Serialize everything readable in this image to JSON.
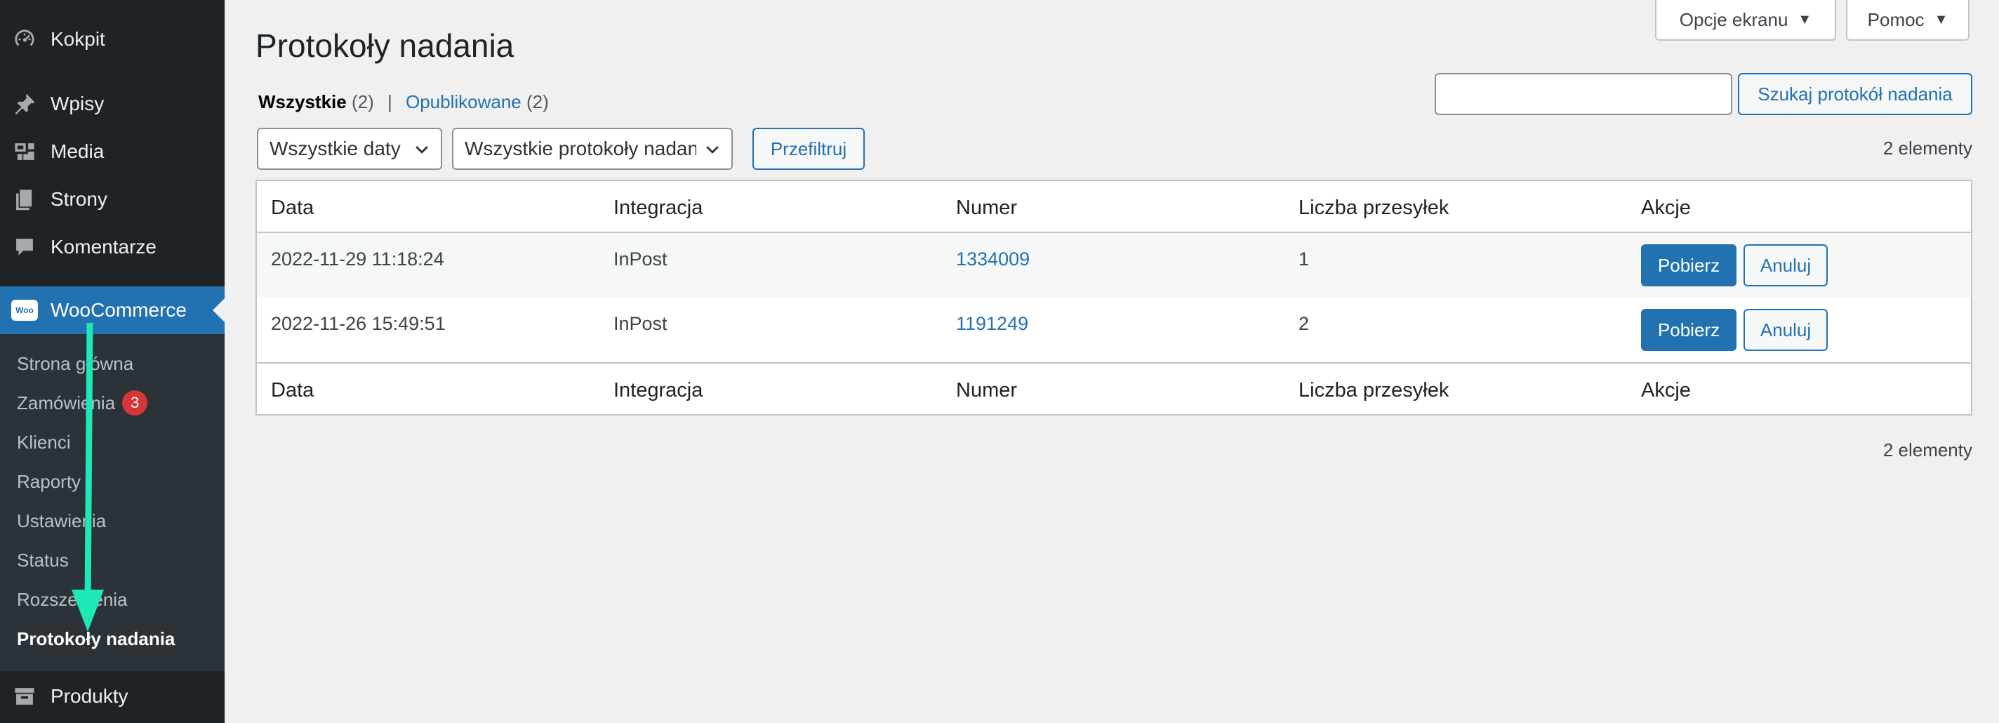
{
  "sidebar": {
    "menu": [
      {
        "label": "Kokpit",
        "icon": "dashboard-icon"
      },
      {
        "label": "Wpisy",
        "icon": "pin-icon"
      },
      {
        "label": "Media",
        "icon": "media-icon"
      },
      {
        "label": "Strony",
        "icon": "pages-icon"
      },
      {
        "label": "Komentarze",
        "icon": "comment-icon"
      },
      {
        "label": "WooCommerce",
        "icon": "woo-icon"
      },
      {
        "label": "Produkty",
        "icon": "archive-icon"
      }
    ],
    "woo_logo_text": "Woo",
    "submenu": [
      {
        "label": "Strona główna"
      },
      {
        "label": "Zamówienia",
        "badge": "3"
      },
      {
        "label": "Klienci"
      },
      {
        "label": "Raporty"
      },
      {
        "label": "Ustawienia"
      },
      {
        "label": "Status"
      },
      {
        "label": "Rozszerzenia"
      },
      {
        "label": "Protokoły nadania"
      }
    ]
  },
  "header": {
    "screen_options": "Opcje ekranu",
    "help": "Pomoc",
    "title": "Protokoły nadania"
  },
  "views": {
    "all_label": "Wszystkie",
    "all_count": "(2)",
    "separator": "|",
    "published_label": "Opublikowane",
    "published_count": "(2)"
  },
  "search": {
    "value": "",
    "button": "Szukaj protokół nadania"
  },
  "filters": {
    "dates": "Wszystkie daty",
    "protocols": "Wszystkie protokoły nadania",
    "button": "Przefiltruj"
  },
  "items_count": "2 elementy",
  "table": {
    "columns": [
      "Data",
      "Integracja",
      "Numer",
      "Liczba przesyłek",
      "Akcje"
    ],
    "rows": [
      {
        "date": "2022-11-29 11:18:24",
        "integration": "InPost",
        "number": "1334009",
        "count": "1",
        "download": "Pobierz",
        "cancel": "Anuluj"
      },
      {
        "date": "2022-11-26 15:49:51",
        "integration": "InPost",
        "number": "1191249",
        "count": "2",
        "download": "Pobierz",
        "cancel": "Anuluj"
      }
    ]
  },
  "colors": {
    "sidebar_bg": "#1d2327",
    "submenu_bg": "#2c3338",
    "accent": "#2271b1",
    "badge": "#d63638",
    "annotation_arrow": "#1de9b6"
  }
}
